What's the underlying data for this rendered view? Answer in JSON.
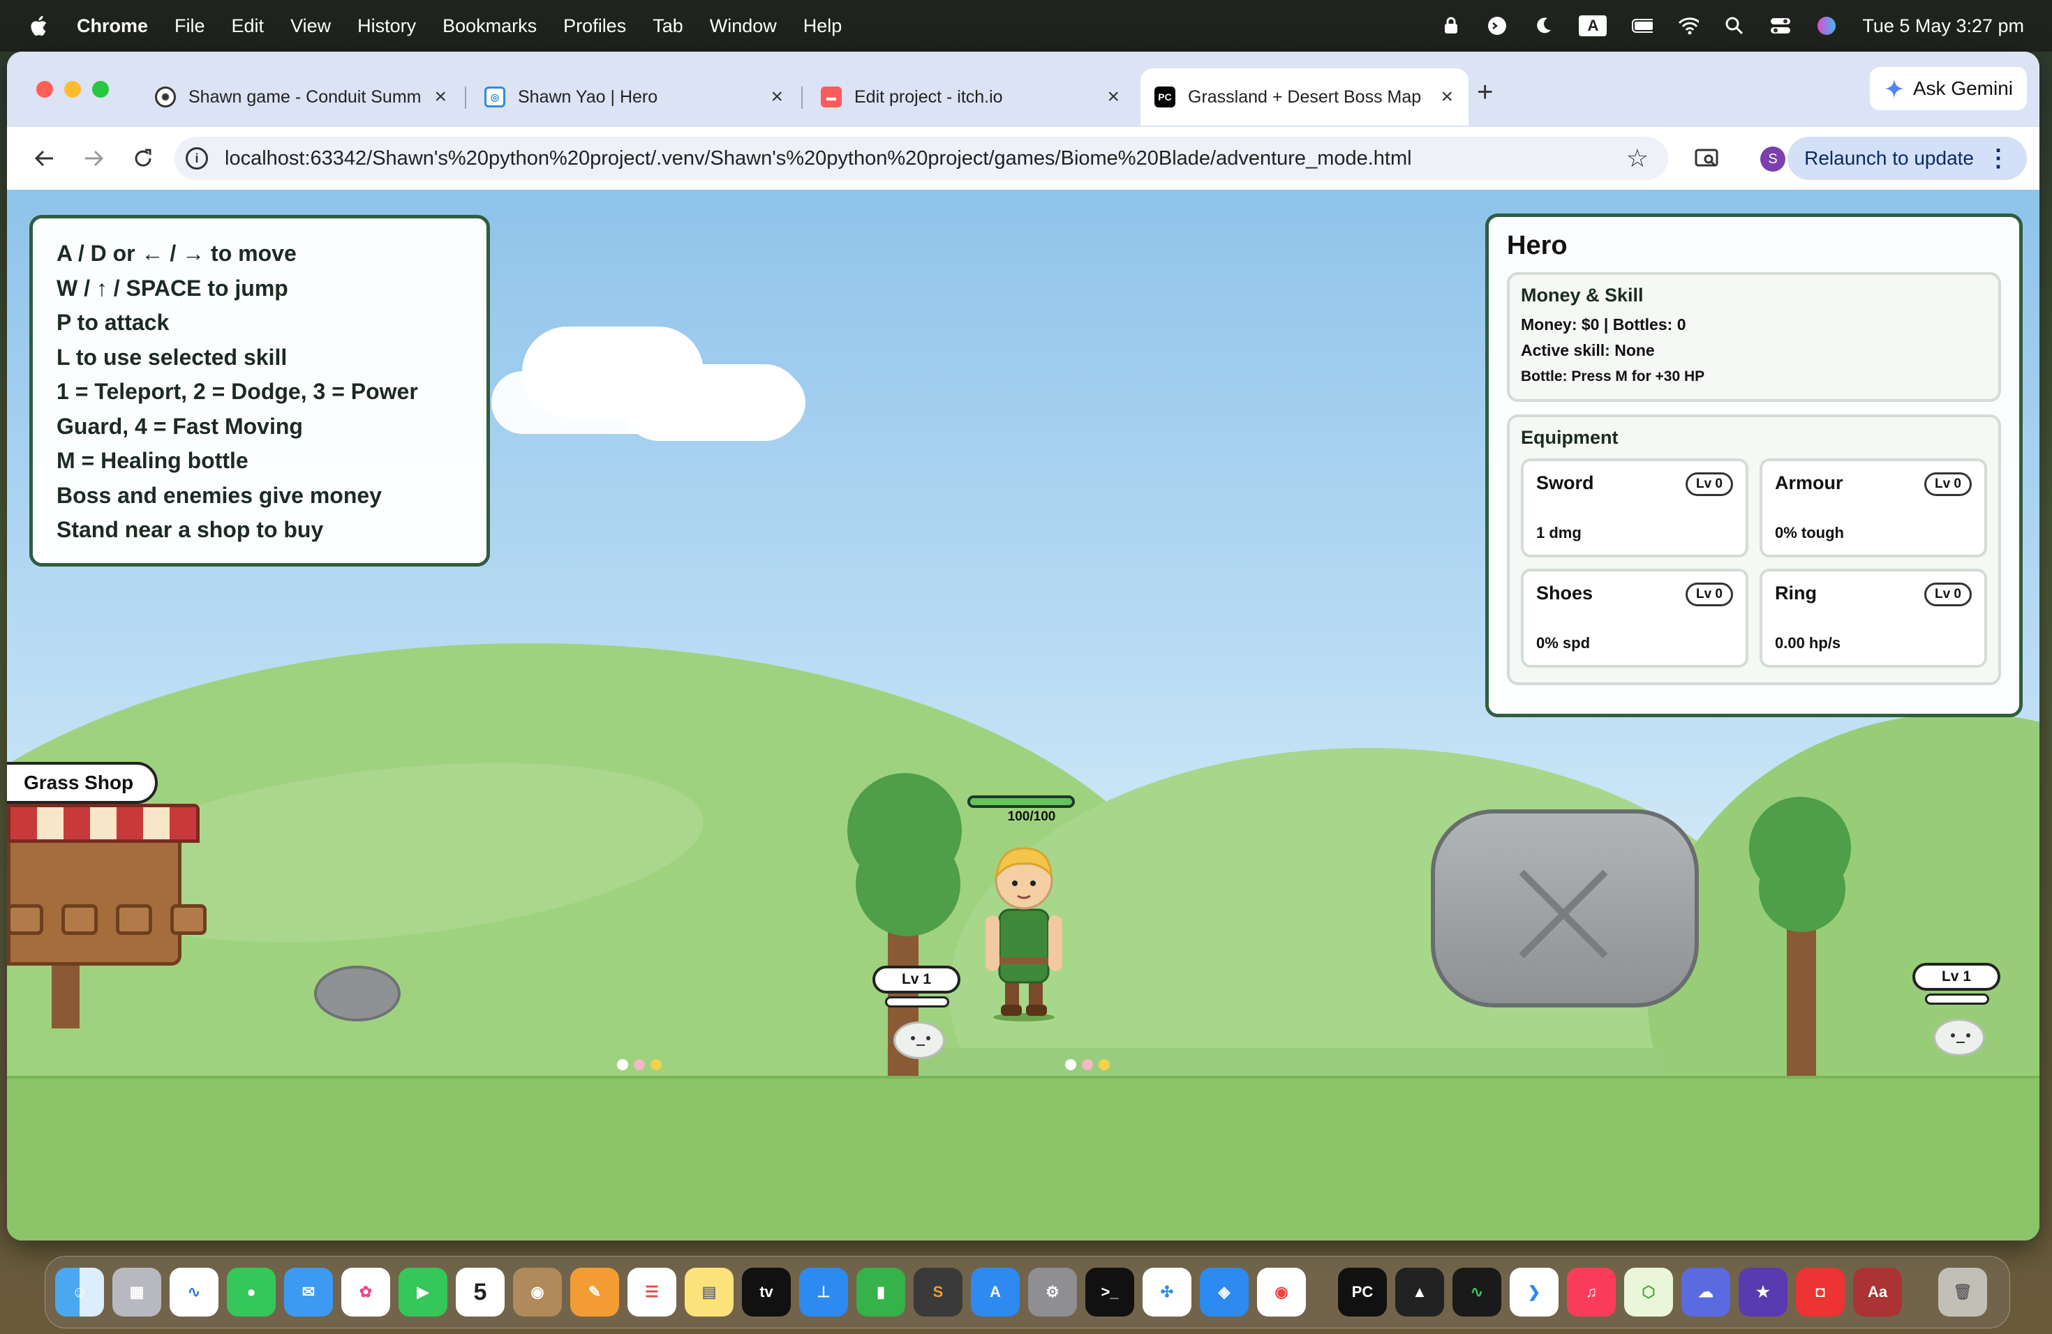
{
  "menubar": {
    "app_name": "Chrome",
    "items": [
      "File",
      "Edit",
      "View",
      "History",
      "Bookmarks",
      "Profiles",
      "Tab",
      "Window",
      "Help"
    ],
    "clock": "Tue 5 May  3:27 pm",
    "input_source": "A"
  },
  "tabs": [
    {
      "title": "Shawn game - Conduit Summ",
      "favicon": "openai-icon"
    },
    {
      "title": "Shawn Yao | Hero",
      "favicon": "replit-icon"
    },
    {
      "title": "Edit project - itch.io",
      "favicon": "itch-icon"
    },
    {
      "title": "Grassland + Desert Boss Map",
      "favicon": "pycharm-icon",
      "active": true
    }
  ],
  "toolbar": {
    "url": "localhost:63342/Shawn's%20python%20project/.venv/Shawn's%20python%20project/games/Biome%20Blade/adventure_mode.html",
    "ask_gemini": "Ask Gemini",
    "relaunch": "Relaunch to update",
    "profile_initial": "S"
  },
  "controls": [
    "A / D or ← / → to move",
    "W / ↑ / SPACE to jump",
    "P to attack",
    "L to use selected skill",
    "1 = Teleport, 2 = Dodge, 3 = Power",
    "Guard, 4 = Fast Moving",
    "M = Healing bottle",
    "Boss and enemies give money",
    "Stand near a shop to buy"
  ],
  "hero": {
    "title": "Hero",
    "money_skill": {
      "title": "Money & Skill",
      "money_line": "Money: $0 | Bottles: 0",
      "skill_line": "Active skill: None",
      "bottle_line": "Bottle: Press M for +30 HP"
    },
    "equipment": {
      "title": "Equipment",
      "items": [
        {
          "name": "Sword",
          "level": "Lv 0",
          "stat": "1 dmg"
        },
        {
          "name": "Armour",
          "level": "Lv 0",
          "stat": "0% tough"
        },
        {
          "name": "Shoes",
          "level": "Lv 0",
          "stat": "0% spd"
        },
        {
          "name": "Ring",
          "level": "Lv 0",
          "stat": "0.00 hp/s"
        }
      ]
    }
  },
  "game": {
    "shop_label": "Grass Shop",
    "hero_hp": "100/100",
    "hero_hp_fraction": 1.0,
    "enemy_levels": [
      "Lv 1",
      "Lv 1"
    ]
  },
  "colors": {
    "panel_border": "#2f5d3f",
    "grass": "#8cc46a",
    "sky": "#b9dcf4"
  }
}
